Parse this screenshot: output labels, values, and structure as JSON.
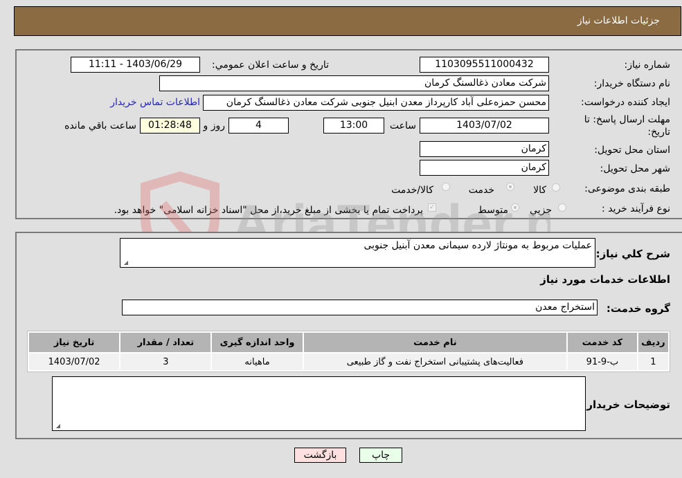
{
  "header": {
    "title": "جزئیات اطلاعات نیاز"
  },
  "form": {
    "need_number": {
      "label": "شماره نیاز:",
      "value": "1103095511000432"
    },
    "announce_datetime": {
      "label": "تاریخ و ساعت اعلان عمومي:",
      "value": "1403/06/29 - 11:11"
    },
    "buyer_org": {
      "label": "نام دستگاه خريدار:",
      "value": "شرکت معادن ذغالسنگ کرمان"
    },
    "requester": {
      "label": "ايجاد کننده درخواست:",
      "value": "محسن حمزه‌علی آباد کارپرداز معدن ابنیل جنوبی شرکت معادن ذغالسنگ کرمان",
      "contact_link": "اطلاعات تماس خريدار"
    },
    "deadline": {
      "label": "مهلت ارسال پاسخ: تا تاريخ:",
      "date": "1403/07/02",
      "time_label": "ساعت",
      "time": "13:00",
      "days": "4",
      "days_label": "روز و",
      "remaining": "01:28:48",
      "remaining_label": "ساعت باقي مانده"
    },
    "province": {
      "label": "استان محل تحويل:",
      "value": "کرمان"
    },
    "city": {
      "label": "شهر محل تحويل:",
      "value": "کرمان"
    },
    "category": {
      "label": "طبقه بندی موضوعی:",
      "options": [
        {
          "label": "کالا",
          "checked": false
        },
        {
          "label": "خدمت",
          "checked": true
        },
        {
          "label": "کالا/خدمت",
          "checked": false
        }
      ]
    },
    "purchase_process": {
      "label": "نوع فرآيند خريد :",
      "options": [
        {
          "label": "جزيي",
          "checked": false
        },
        {
          "label": "متوسط",
          "checked": true
        }
      ],
      "payment_note": "پرداخت تمام یا بخشی از مبلغ خرید،از محل \"اسناد خزانه اسلامی\" خواهد بود."
    }
  },
  "details": {
    "description_label": "شرح کلي نياز:",
    "description": "عملیات مربوط به مونتاژ لارده سیمانی معدن آبنیل جنوبی",
    "services_heading": "اطلاعات خدمات مورد نياز",
    "service_group_label": "گروه خدمت:",
    "service_group": "استخراج معدن",
    "table": {
      "headers": [
        "رديف",
        "کد خدمت",
        "نام خدمت",
        "واحد اندازه گيری",
        "تعداد / مقدار",
        "تاريخ نياز"
      ],
      "rows": [
        [
          "1",
          "ب-9-91",
          "فعالیت‌های پشتیبانی استخراج نفت و گاز طبیعی",
          "ماهیانه",
          "3",
          "1403/07/02"
        ]
      ]
    },
    "buyer_notes_label": "توضيحات خريدار:",
    "buyer_notes": ""
  },
  "buttons": {
    "print": "چاپ",
    "back": "بازگشت"
  },
  "watermark": {
    "text": "AriaTender.neT"
  }
}
